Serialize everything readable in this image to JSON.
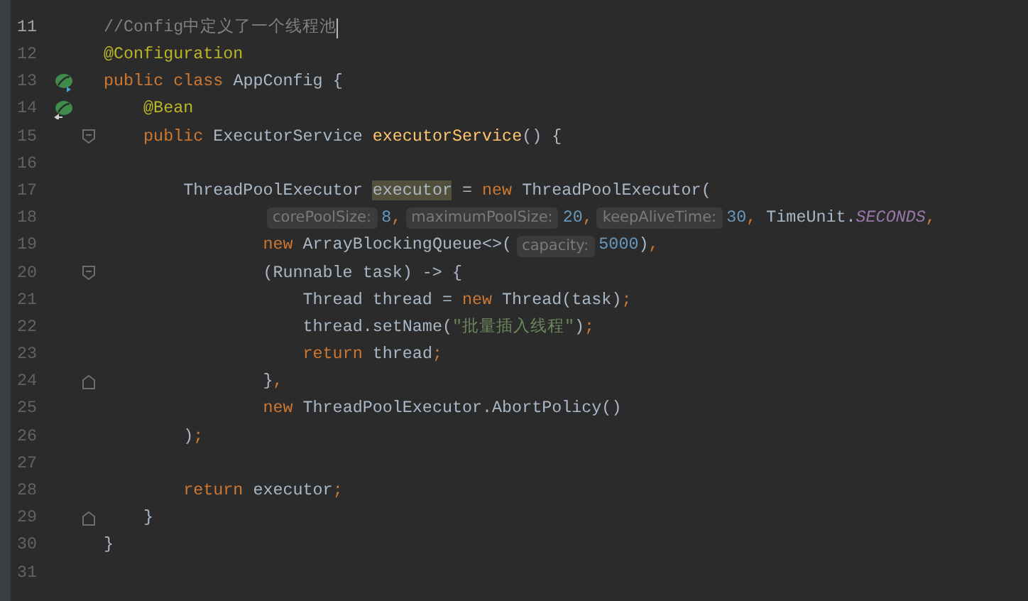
{
  "editor": {
    "lines": [
      {
        "number": "11",
        "current": true,
        "tokens": [
          {
            "kind": "comment",
            "text": "//Config中定义了一个线程池"
          }
        ]
      },
      {
        "number": "12",
        "current": false,
        "tokens": [
          {
            "kind": "annotation",
            "text": "@Configuration"
          }
        ]
      },
      {
        "number": "13",
        "current": false,
        "gutter_icon": {
          "kind": "class"
        },
        "tokens": [
          {
            "kind": "kw",
            "text": "public class "
          },
          {
            "kind": "type",
            "text": "AppConfig {"
          }
        ]
      },
      {
        "number": "14",
        "current": false,
        "gutter_icon": {
          "kind": "method"
        },
        "tokens": [
          {
            "kind": "annotation",
            "text": "    @Bean"
          }
        ]
      },
      {
        "number": "15",
        "current": false,
        "fold_marker": {
          "kind": "start"
        },
        "tokens": [
          {
            "kind": "kw",
            "text": "    public "
          },
          {
            "kind": "type",
            "text": "ExecutorService "
          },
          {
            "kind": "method",
            "text": "executorService"
          },
          {
            "kind": "plain",
            "text": "() {"
          }
        ]
      },
      {
        "number": "16",
        "current": false
      },
      {
        "number": "17",
        "current": false,
        "tokens": [
          {
            "kind": "type",
            "text": "        ThreadPoolExecutor "
          },
          {
            "kind": "highlight",
            "text": "executor"
          },
          {
            "kind": "plain",
            "text": " = "
          },
          {
            "kind": "kw",
            "text": "new "
          },
          {
            "kind": "type",
            "text": "ThreadPoolExecutor("
          }
        ]
      },
      {
        "number": "18",
        "current": false,
        "tokens": [
          {
            "kind": "hint",
            "text": "corePoolSize:"
          },
          {
            "kind": "number",
            "text": "8"
          },
          {
            "kind": "kw",
            "text": ","
          },
          {
            "kind": "hint",
            "text": "maximumPoolSize:"
          },
          {
            "kind": "number",
            "text": "20"
          },
          {
            "kind": "kw",
            "text": ","
          },
          {
            "kind": "hint",
            "text": "keepAliveTime:"
          },
          {
            "kind": "number",
            "text": "30"
          },
          {
            "kind": "kw",
            "text": ", "
          },
          {
            "kind": "plain",
            "text": "TimeUnit."
          },
          {
            "kind": "static",
            "text": "SECONDS"
          },
          {
            "kind": "kw",
            "text": ","
          }
        ]
      },
      {
        "number": "19",
        "current": false,
        "tokens": [
          {
            "kind": "kw",
            "text": "                new "
          },
          {
            "kind": "type",
            "text": "ArrayBlockingQueue<>("
          },
          {
            "kind": "hint",
            "text": "capacity:"
          },
          {
            "kind": "number",
            "text": "5000"
          },
          {
            "kind": "plain",
            "text": ")"
          },
          {
            "kind": "kw",
            "text": ","
          }
        ]
      },
      {
        "number": "20",
        "current": false,
        "fold_marker": {
          "kind": "start"
        },
        "tokens": [
          {
            "kind": "plain",
            "text": "                (Runnable task) -> {"
          }
        ]
      },
      {
        "number": "21",
        "current": false,
        "tokens": [
          {
            "kind": "plain",
            "text": "                    Thread thread = "
          },
          {
            "kind": "kw",
            "text": "new "
          },
          {
            "kind": "plain",
            "text": "Thread(task)"
          },
          {
            "kind": "kw",
            "text": ";"
          }
        ]
      },
      {
        "number": "22",
        "current": false,
        "tokens": [
          {
            "kind": "plain",
            "text": "                    thread.setName("
          },
          {
            "kind": "string",
            "text": "\"批量插入线程\""
          },
          {
            "kind": "plain",
            "text": ")"
          },
          {
            "kind": "kw",
            "text": ";"
          }
        ]
      },
      {
        "number": "23",
        "current": false,
        "tokens": [
          {
            "kind": "kw",
            "text": "                    return "
          },
          {
            "kind": "plain",
            "text": "thread"
          },
          {
            "kind": "kw",
            "text": ";"
          }
        ]
      },
      {
        "number": "24",
        "current": false,
        "fold_marker": {
          "kind": "end"
        },
        "tokens": [
          {
            "kind": "plain",
            "text": "                }"
          },
          {
            "kind": "kw",
            "text": ","
          }
        ]
      },
      {
        "number": "25",
        "current": false,
        "tokens": [
          {
            "kind": "kw",
            "text": "                new "
          },
          {
            "kind": "plain",
            "text": "ThreadPoolExecutor.AbortPolicy()"
          }
        ]
      },
      {
        "number": "26",
        "current": false,
        "tokens": [
          {
            "kind": "plain",
            "text": "        )"
          },
          {
            "kind": "kw",
            "text": ";"
          }
        ]
      },
      {
        "number": "27",
        "current": false
      },
      {
        "number": "28",
        "current": false,
        "tokens": [
          {
            "kind": "kw",
            "text": "        return "
          },
          {
            "kind": "plain",
            "text": "executor"
          },
          {
            "kind": "kw",
            "text": ";"
          }
        ]
      },
      {
        "number": "29",
        "current": false,
        "fold_marker": {
          "kind": "end"
        },
        "tokens": [
          {
            "kind": "plain",
            "text": "    }"
          }
        ]
      },
      {
        "number": "30",
        "current": false,
        "tokens": [
          {
            "kind": "plain",
            "text": "}"
          }
        ]
      },
      {
        "number": "31",
        "current": false
      }
    ]
  }
}
